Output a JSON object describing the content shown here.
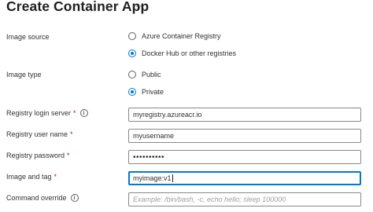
{
  "header": {
    "title": "Create Container App",
    "more_label": "···"
  },
  "form": {
    "image_source": {
      "label": "Image source",
      "options": [
        {
          "label": "Azure Container Registry",
          "selected": false
        },
        {
          "label": "Docker Hub or other registries",
          "selected": true
        }
      ]
    },
    "image_type": {
      "label": "Image type",
      "options": [
        {
          "label": "Public",
          "selected": false
        },
        {
          "label": "Private",
          "selected": true
        }
      ]
    },
    "registry_login_server": {
      "label": "Registry login server",
      "required_mark": "*",
      "info_icon": "info-icon",
      "value": "myregistry.azureacr.io"
    },
    "registry_user_name": {
      "label": "Registry user name",
      "required_mark": "*",
      "value": "myusername"
    },
    "registry_password": {
      "label": "Registry password",
      "required_mark": "*",
      "value": "••••••••••"
    },
    "image_and_tag": {
      "label": "Image and tag",
      "required_mark": "*",
      "value": "myimage:v1"
    },
    "command_override": {
      "label": "Command override",
      "info_icon": "info-icon",
      "placeholder": "Example: /bin/bash, -c, echo hello; sleep 100000"
    }
  },
  "colors": {
    "accent": "#0078d4",
    "required": "#a4262c",
    "border": "#8a8886"
  }
}
